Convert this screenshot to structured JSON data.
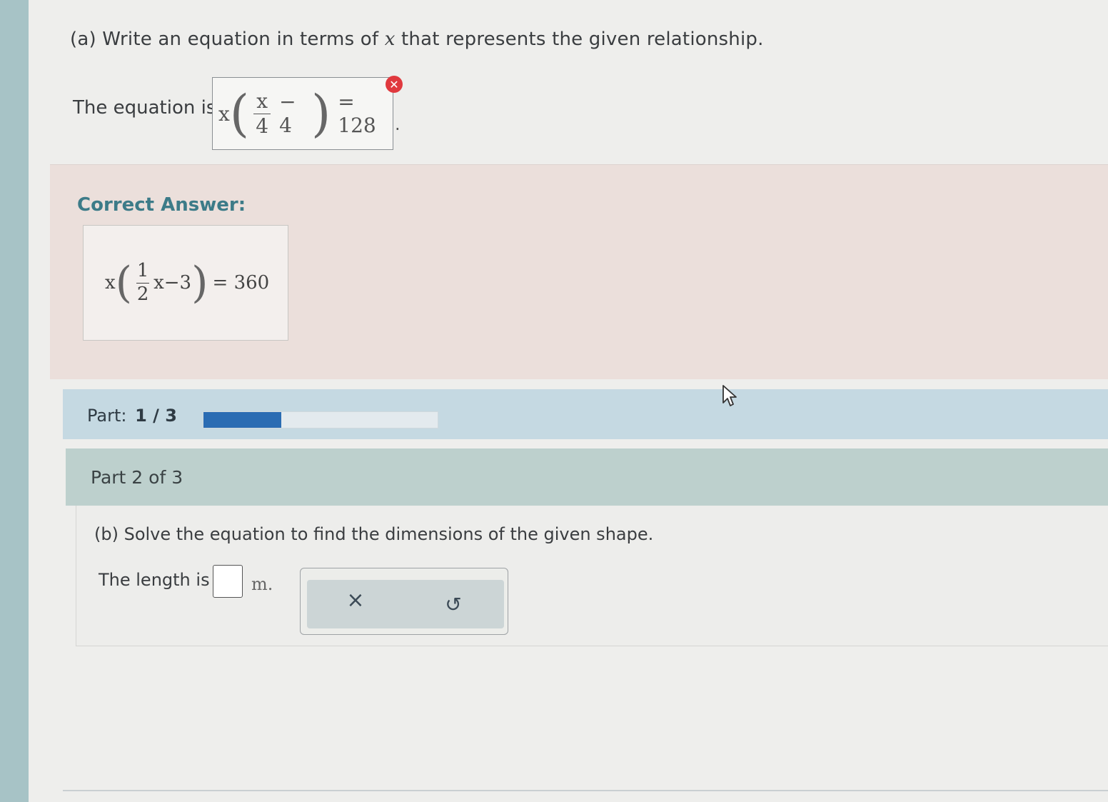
{
  "part_a": {
    "question_prefix": "(a) Write an equation in terms of ",
    "question_var": "x",
    "question_suffix": " that represents the given relationship.",
    "equation_label": "The equation is",
    "student_answer": {
      "lead": "x",
      "numerator": "x",
      "denominator": "4",
      "inner_rest": "− 4",
      "rhs": "= 128"
    },
    "status": "incorrect",
    "after_mark": "."
  },
  "correct_answer": {
    "title": "Correct Answer:",
    "lead": "x",
    "numerator": "1",
    "denominator": "2",
    "inner_rest": "x−3",
    "rhs": "= 360"
  },
  "progress": {
    "label": "Part:",
    "current": "1",
    "separator": "/",
    "total": "3",
    "fill_fraction": 0.333
  },
  "part_b": {
    "header": "Part 2 of 3",
    "question": "(b) Solve the equation to find the dimensions of the given shape.",
    "length_label": "The length is",
    "length_value": "",
    "unit": "m.",
    "clear_icon": "×",
    "undo_icon": "↺"
  },
  "colors": {
    "accent_blue": "#2a6cb3",
    "correct_title": "#3c7b88",
    "error_red": "#e0393e"
  }
}
